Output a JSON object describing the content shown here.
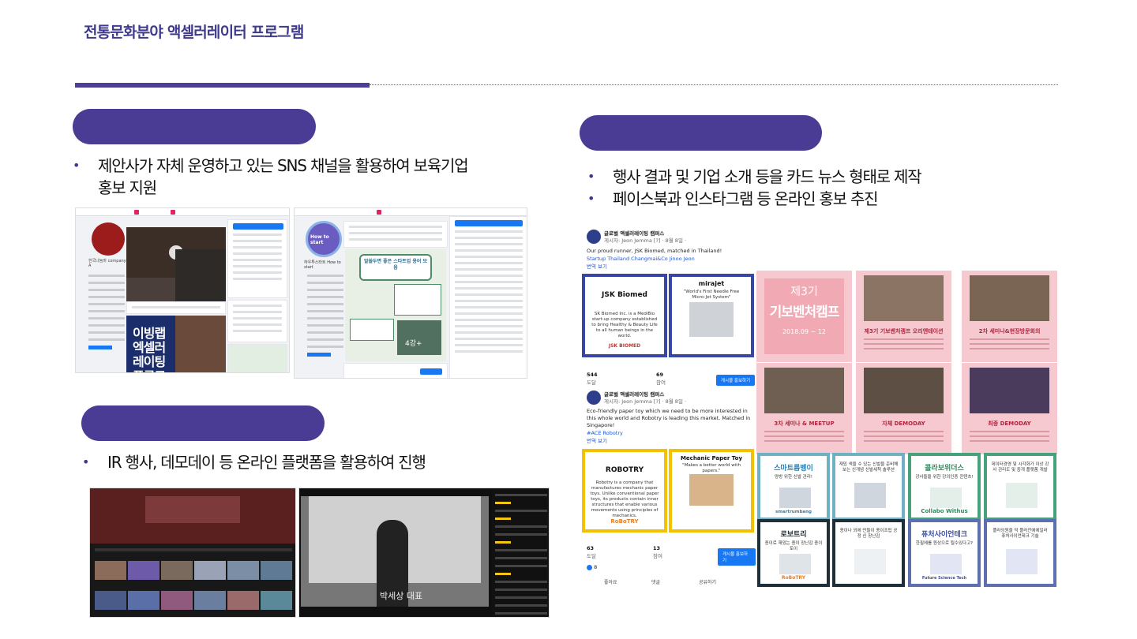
{
  "page": {
    "title": "전통문화분야 액셀러레이터 프로그램"
  },
  "sections": {
    "sns": {
      "bullets": [
        "제안사가 자체 운영하고 있는 SNS 채널을 활용하여 보육기업 홍보 지원"
      ]
    },
    "cardnews": {
      "bullets": [
        "행사 결과 및 기업 소개 등을 카드 뉴스 형태로 제작",
        "페이스북과 인스타그램 등 온라인 홍보 추진"
      ]
    },
    "ir": {
      "bullets": [
        "IR 행사, 데모데이 등 온라인 플랫폼을 활용하여 진행"
      ]
    }
  },
  "screenshots": {
    "fb_page1": {
      "name": "한국나눔마 company A",
      "poster_text": "이빙랩 엑셀러레이팅 프로그램"
    },
    "fb_page2": {
      "page_name": "하우투스타트 How to start",
      "logo_text": "How to start",
      "poster_title": "알쓸두면 좋은 스타트업 용어 모음",
      "poster_count": "4강+"
    },
    "yt_stream": {
      "caption": "박세상 대표"
    }
  },
  "fb_post": {
    "page_name": "글로벌 액셀러레이팅 캠퍼스",
    "author": "게시자: Jeon Jemma [?] · 8월 8일 ·",
    "post1_text": "Our proud runner, JSK Biomed, matched in Thailand!",
    "post1_link": "Startup Thailand Changmai&Co Jinoo Jeon",
    "see_more": "번역 보기",
    "tile1_title": "JSK Biomed",
    "tile1_body": "SK Biomed Inc. is a MediBio start-up company established to bring Healthy & Beauty Life to all human beings in the world.",
    "tile1_logo": "JSK BIOMED",
    "tile2_title": "mirajet",
    "tile2_sub": "\"World's First Needle Free Micro-Jet System\"",
    "stats1_reach": "544",
    "stats1_reach_label": "도달",
    "stats1_engage": "69",
    "stats1_engage_label": "참여",
    "boost_label": "게시물 홍보하기",
    "post2_text": "Eco-friendly paper toy which we need to be more interested in this whole world and Robotry is leading this market. Matched in Singapore!",
    "post2_tag": "#ACE Robotry",
    "tile3_title": "ROBOTRY",
    "tile3_body": "Robotry is a company that manufactures mechanic paper toys. Unlike conventional paper toys, its products contain inner structures that enable various movements using principles of mechanics.",
    "tile3_logo": "RoBoTRY",
    "tile4_title": "Mechanic Paper Toy",
    "tile4_sub": "\"Makes a better world with papers.\"",
    "stats2_reach": "63",
    "stats2_engage": "13",
    "likes": "8",
    "actions": [
      "좋아요",
      "댓글",
      "공유하기"
    ]
  },
  "card_grid": {
    "pink": [
      {
        "big_num": "제3기",
        "big_title": "기보벤처캠프",
        "date": "2018.09 ~ 12"
      },
      {
        "caption": "제3기 기보벤처캠프 오리엔테이션"
      },
      {
        "caption": "2차 세미나&현장방문회의"
      },
      {
        "caption": "3차 세미나 & MEETUP"
      },
      {
        "caption": "자체 DEMODAY"
      },
      {
        "caption": "최종 DEMODAY"
      }
    ],
    "news": [
      {
        "title": "스마트름벵이",
        "sub": "양방 위한 신발 관리!",
        "brand": "smartrumbang"
      },
      {
        "title": "",
        "sub": "재밌 색을 수 있는 신발을 준비해보는 신개념 신발세척 솔루션",
        "brand": ""
      },
      {
        "title": "콜라보위더스",
        "sub": "강사들을 위한 강의인증 콘텐츠!",
        "brand": "Collabo Withus"
      },
      {
        "title": "",
        "sub": "데이터경영 및 시각화가 이상 강사 관리도 및 중개 플랫폼 개발",
        "brand": ""
      },
      {
        "title": "로보트리",
        "sub": "종이로 재밌는 종이 장난감 종이토이",
        "brand": "RoBoTRY"
      },
      {
        "title": "",
        "sub": "종이나 외에 만들이 종이조립 공정 신 장난감",
        "brand": ""
      },
      {
        "title": "퓨처사이언테크",
        "sub": "한필에를 원상으로 될수있다고?",
        "brand": "Future Science Tech"
      },
      {
        "title": "",
        "sub": "플라잉원을 덕 플러잔에에일러 퓨처사이언테크 기술",
        "brand": ""
      }
    ]
  },
  "colors": {
    "accent": "#4a3b95",
    "title": "#3f3a8c",
    "pink": "#f5c9cf",
    "navy": "#3a46a4"
  }
}
